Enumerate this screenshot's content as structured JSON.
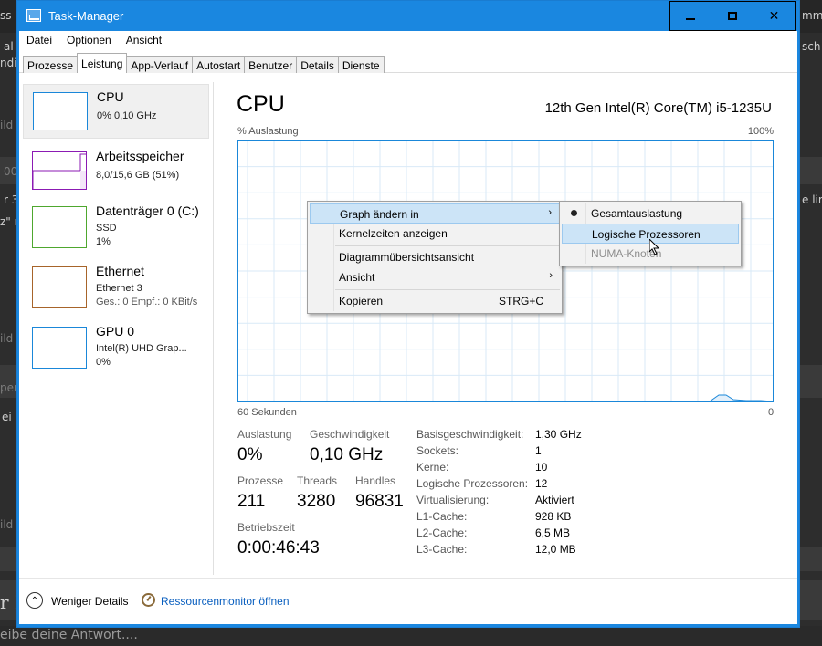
{
  "background": {
    "fragments_top": [
      "ss",
      "mm"
    ],
    "fragments_mid": [
      "al",
      "sch",
      "ndi"
    ],
    "fragments_misc": [
      "ild",
      "00",
      "r 3",
      "z\" n",
      "e lim",
      "ild",
      "per",
      "ei",
      "ild",
      "r B"
    ],
    "bottom_placeholder": "eibe deine Antwort...."
  },
  "window": {
    "title": "Task-Manager",
    "colors": {
      "frame": "#1a87e0",
      "accent": "#1a87d9"
    }
  },
  "menu": [
    "Datei",
    "Optionen",
    "Ansicht"
  ],
  "tabs": [
    "Prozesse",
    "Leistung",
    "App-Verlauf",
    "Autostart",
    "Benutzer",
    "Details",
    "Dienste"
  ],
  "active_tab": "Leistung",
  "sidebar": {
    "items": [
      {
        "title": "CPU",
        "lines": [
          "0% 0,10 GHz"
        ],
        "color": "#1a87d9"
      },
      {
        "title": "Arbeitsspeicher",
        "lines": [
          "8,0/15,6 GB (51%)"
        ],
        "color": "#8b1ab3"
      },
      {
        "title": "Datenträger 0 (C:)",
        "lines": [
          "SSD",
          "1%"
        ],
        "color": "#4ea72e"
      },
      {
        "title": "Ethernet",
        "lines": [
          "Ethernet 3",
          "Ges.: 0 Empf.: 0 KBit/s"
        ],
        "color": "#a7642a"
      },
      {
        "title": "GPU 0",
        "lines": [
          "Intel(R) UHD Grap...",
          "0%"
        ],
        "color": "#1a87d9"
      }
    ]
  },
  "main": {
    "title": "CPU",
    "model": "12th Gen Intel(R) Core(TM) i5-1235U",
    "graph": {
      "y_label": "% Auslastung",
      "y_max": "100%",
      "x_label": "60 Sekunden",
      "x_min": "0"
    },
    "stats": {
      "auslastung": {
        "label": "Auslastung",
        "value": "0%"
      },
      "geschwindigkeit": {
        "label": "Geschwindigkeit",
        "value": "0,10 GHz"
      },
      "prozesse": {
        "label": "Prozesse",
        "value": "211"
      },
      "threads": {
        "label": "Threads",
        "value": "3280"
      },
      "handles": {
        "label": "Handles",
        "value": "96831"
      },
      "betriebszeit": {
        "label": "Betriebszeit",
        "value": "0:00:46:43"
      }
    },
    "details": [
      {
        "label": "Basisgeschwindigkeit:",
        "value": "1,30 GHz"
      },
      {
        "label": "Sockets:",
        "value": "1"
      },
      {
        "label": "Kerne:",
        "value": "10"
      },
      {
        "label": "Logische Prozessoren:",
        "value": "12"
      },
      {
        "label": "Virtualisierung:",
        "value": "Aktiviert"
      },
      {
        "label": "L1-Cache:",
        "value": "928 KB"
      },
      {
        "label": "L2-Cache:",
        "value": "6,5 MB"
      },
      {
        "label": "L3-Cache:",
        "value": "12,0 MB"
      }
    ]
  },
  "footer": {
    "less_details": "Weniger Details",
    "resource_monitor": "Ressourcenmonitor öffnen"
  },
  "context_menu": {
    "items": [
      {
        "label": "Graph ändern in",
        "has_submenu": true
      },
      {
        "label": "Kernelzeiten anzeigen"
      },
      {
        "label": "Diagrammübersichtsansicht"
      },
      {
        "label": "Ansicht",
        "has_submenu": true
      },
      {
        "label": "Kopieren",
        "shortcut": "STRG+C"
      }
    ],
    "submenu": [
      {
        "label": "Gesamtauslastung",
        "selected": true
      },
      {
        "label": "Logische Prozessoren",
        "highlighted": true
      },
      {
        "label": "NUMA-Knoten",
        "disabled": true
      }
    ]
  }
}
